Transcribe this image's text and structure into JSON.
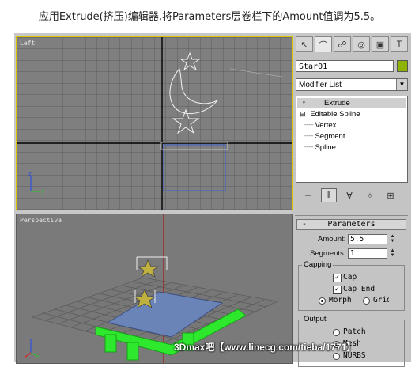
{
  "caption": "应用Extrude(挤压)编辑器,将Parameters层卷栏下的Amount值调为5.5。",
  "viewports": {
    "left_label": "Left",
    "persp_label": "Perspective"
  },
  "panel": {
    "tabs": [
      "create-tab",
      "modify-tab",
      "hierarchy-tab",
      "motion-tab",
      "display-tab",
      "utilities-tab"
    ],
    "object_name": "Star01",
    "object_color": "#8cb400",
    "modifier_list": "Modifier List",
    "stack": {
      "extrude": "Extrude",
      "editable_spline": "Editable Spline",
      "vertex": "Vertex",
      "segment": "Segment",
      "spline": "Spline"
    }
  },
  "parameters": {
    "title": "Parameters",
    "amount_label": "Amount:",
    "amount_value": "5.5",
    "segments_label": "Segments:",
    "segments_value": "1",
    "capping_title": "Capping",
    "cap_start": "Cap",
    "cap_end": "Cap End",
    "morph": "Morph",
    "grid": "Grid",
    "output_title": "Output",
    "patch": "Patch",
    "mesh": "Mesh",
    "nurbs": "NURBS"
  },
  "watermark": "3Dmax吧【www.linecg.com/tieba/1771】"
}
